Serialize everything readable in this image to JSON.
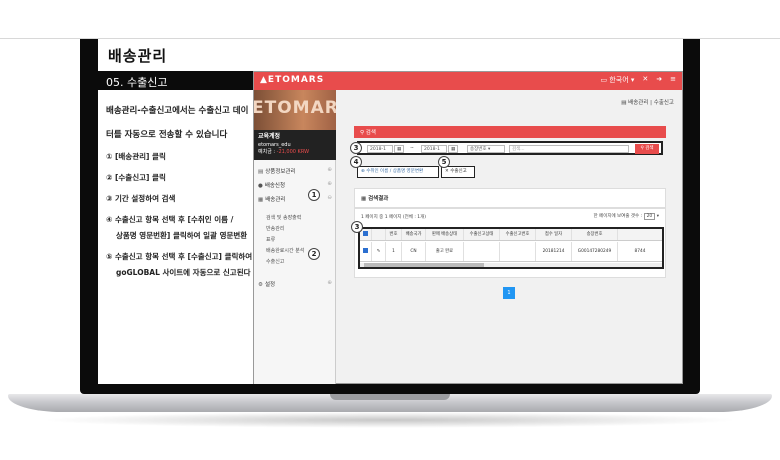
{
  "page": {
    "title": "배송관리",
    "section": "05. 수출신고",
    "description": "배송관리-수출신고에서는 수출신고 데이터를 자동으로 전송할 수 있습니다",
    "steps": [
      {
        "num": "①",
        "text": "[배송관리] 클릭"
      },
      {
        "num": "②",
        "text": "[수출신고] 클릭"
      },
      {
        "num": "③",
        "text": "기간 설정하여 검색"
      },
      {
        "num": "④",
        "text": "수출신고 항목 선택 후 [수취인 이름 /",
        "cont": "상품명 영문번환] 클릭하여 일괄 영문변환"
      },
      {
        "num": "⑤",
        "text": "수출신고 항목 선택 후 [수출신고] 클릭하여",
        "cont": "goGLOBAL 사이트에 자동으로 신고된다"
      }
    ]
  },
  "app": {
    "brand": "ETOMARS",
    "top_icons": [
      "▭ 한국어 ▾",
      "✕",
      "➜",
      "≡"
    ],
    "banner_text": "ETOMARS",
    "profile": {
      "name": "교육계정",
      "id": "etomars_edu",
      "balance_label": "예치금 :",
      "balance": "-21,000 KRW"
    },
    "menu": [
      {
        "label": "상품정보관리",
        "icon": "▤"
      },
      {
        "label": "배송신청",
        "icon": "●"
      },
      {
        "label": "배송관리",
        "icon": "▦"
      }
    ],
    "submenu": [
      "검색 및 송장출력",
      "반송관리",
      "표류",
      "배송완료시간 분석",
      "수출신고"
    ],
    "settings": "설정",
    "breadcrumb": "▤ 배송관리   |   수출신고",
    "search": {
      "title": "검색",
      "date_from": "2018-1",
      "date_to": "2018-1",
      "tilde": "~",
      "select": "송장번호",
      "placeholder": "검색...",
      "button": "검색"
    },
    "actions": {
      "convert": "수취인 이름 / 상품명 영문변환",
      "declare": "수출신고"
    },
    "results": {
      "title": "검색결과",
      "pageinfo": "1 페이지 중 1 페이지 (전체 : 1개)",
      "perpage_label": "한 페이지에 보여줄 갯수 :",
      "perpage": "20"
    },
    "table": {
      "headers": [
        "",
        "",
        "번호",
        "배송국가",
        "판매 배송상태",
        "수출신고상태",
        "수출신고번호",
        "접수 일자",
        "송장번호",
        ""
      ],
      "row": [
        "",
        "✎",
        "1",
        "CN",
        "출고 완료",
        "",
        "",
        "20181214",
        "G00147280249",
        "8744"
      ]
    },
    "pager": "1",
    "markers": [
      "1",
      "2",
      "3",
      "4",
      "5",
      "3"
    ]
  }
}
